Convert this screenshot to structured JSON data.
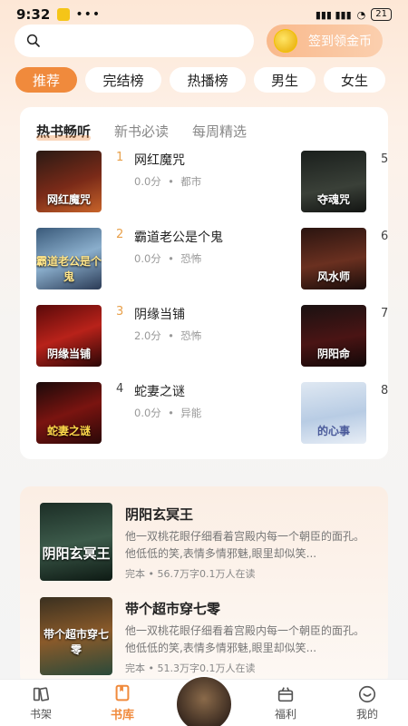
{
  "status": {
    "time": "9:32",
    "battery": "21"
  },
  "checkin_label": "签到领金币",
  "categories": [
    "推荐",
    "完结榜",
    "热播榜",
    "男生",
    "女生"
  ],
  "rank_tabs": [
    "热书畅听",
    "新书必读",
    "每周精选"
  ],
  "books_left": [
    {
      "rank": "1",
      "title": "网红魔咒",
      "score": "0.0分",
      "sep": "•",
      "genre": "都市",
      "cover_text": "网红魔咒"
    },
    {
      "rank": "2",
      "title": "霸道老公是个鬼",
      "score": "0.0分",
      "sep": "•",
      "genre": "恐怖",
      "cover_text": "霸道老公是个鬼"
    },
    {
      "rank": "3",
      "title": "阴缘当铺",
      "score": "2.0分",
      "sep": "•",
      "genre": "恐怖",
      "cover_text": "阴缘当铺"
    },
    {
      "rank": "4",
      "title": "蛇妻之谜",
      "score": "0.0分",
      "sep": "•",
      "genre": "异能",
      "cover_text": "蛇妻之谜"
    }
  ],
  "books_right": [
    {
      "rank": "5",
      "cover_text": "夺魂咒"
    },
    {
      "rank": "6",
      "cover_text": "风水师"
    },
    {
      "rank": "7",
      "cover_text": "阴阳命"
    },
    {
      "rank": "8",
      "cover_text": "的心事"
    }
  ],
  "recommend": [
    {
      "title": "阴阳玄冥王",
      "desc": "他一双桃花眼仔细看着宫殿内每一个朝臣的面孔。他低低的笑,表情多情邪魅,眼里却似笑...",
      "meta": "完本 • 56.7万字0.1万人在读",
      "cover_text": "阴阳玄冥王"
    },
    {
      "title": "带个超市穿七零",
      "desc": "他一双桃花眼仔细看着宫殿内每一个朝臣的面孔。他低低的笑,表情多情邪魅,眼里却似笑...",
      "meta": "完本 • 51.3万字0.1万人在读",
      "cover_text": "带个超市穿七零"
    }
  ],
  "nav": [
    {
      "label": "书架",
      "icon": "bookshelf-icon"
    },
    {
      "label": "书库",
      "icon": "library-icon"
    },
    {
      "label": "",
      "icon": "player-cover"
    },
    {
      "label": "福利",
      "icon": "gift-icon"
    },
    {
      "label": "我的",
      "icon": "profile-icon"
    }
  ],
  "colors": {
    "accent": "#f08a3c",
    "rank_hot": "#e8a04a"
  }
}
